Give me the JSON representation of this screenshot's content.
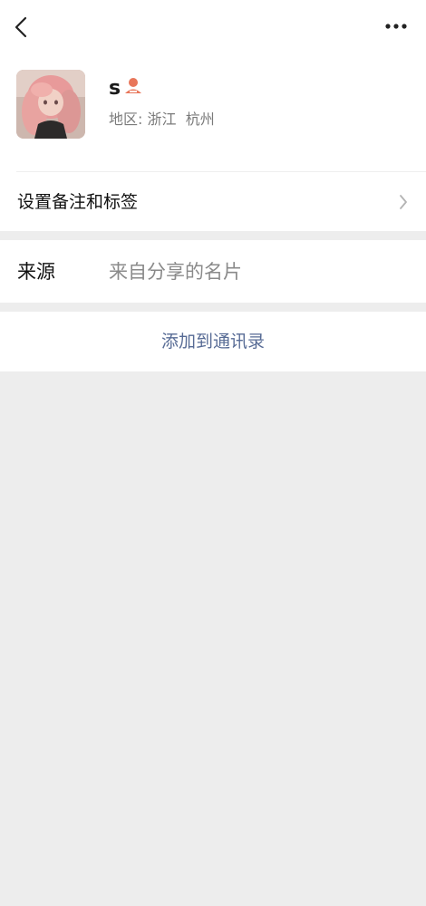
{
  "nav": {
    "back_icon": "chevron-left-icon",
    "more_icon": "more-horizontal-icon"
  },
  "profile": {
    "name": "s",
    "gender_icon": "person-icon",
    "gender_icon_color": "#e8765a",
    "region_label": "地区:",
    "province": "浙江",
    "city": "杭州"
  },
  "remark_row": {
    "label": "设置备注和标签",
    "chevron_icon": "chevron-right-icon"
  },
  "source": {
    "label": "来源",
    "value": "来自分享的名片"
  },
  "actions": {
    "add_contact": "添加到通讯录"
  },
  "colors": {
    "background": "#ededed",
    "card": "#ffffff",
    "link_blue": "#576b95"
  }
}
